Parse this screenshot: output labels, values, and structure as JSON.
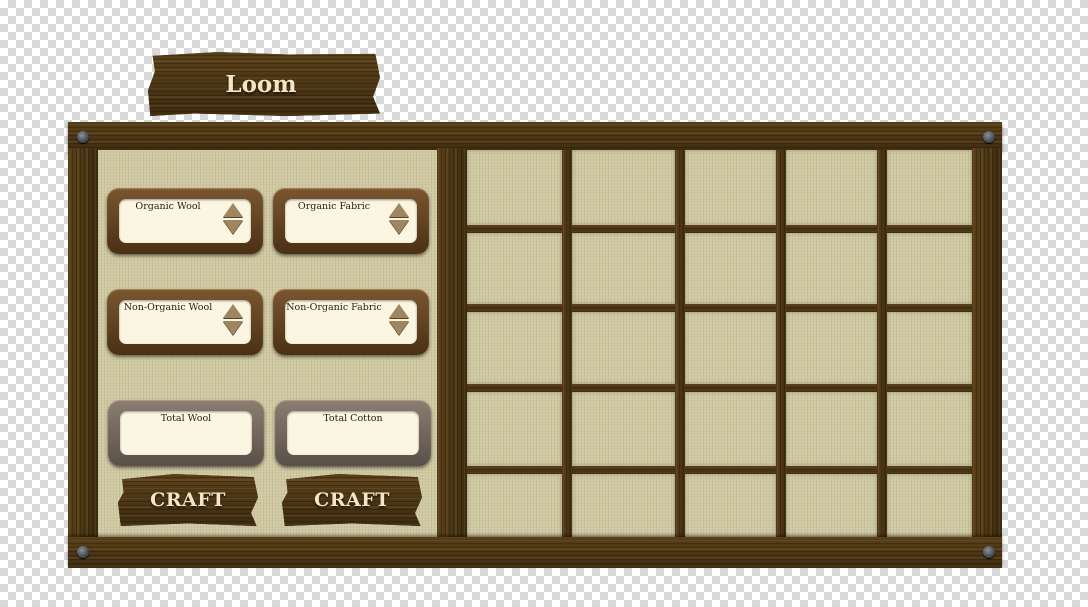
{
  "title": "Loom",
  "fields": {
    "organic_wool": {
      "label": "Organic Wool"
    },
    "organic_fabric": {
      "label": "Organic Fabric"
    },
    "non_organic_wool": {
      "label": "Non-Organic Wool"
    },
    "non_organic_fabric": {
      "label": "Non-Organic Fabric"
    },
    "total_wool": {
      "label": "Total Wool"
    },
    "total_cotton": {
      "label": "Total Cotton"
    }
  },
  "buttons": {
    "craft_left": "CRAFT",
    "craft_right": "CRAFT"
  },
  "inventory": {
    "rows": 5,
    "columns": 5
  },
  "colors": {
    "wood": "#4a3514",
    "linen": "#cfc8a0",
    "field_bg": "#fbf6e2",
    "text_light": "#f2e6c4"
  }
}
